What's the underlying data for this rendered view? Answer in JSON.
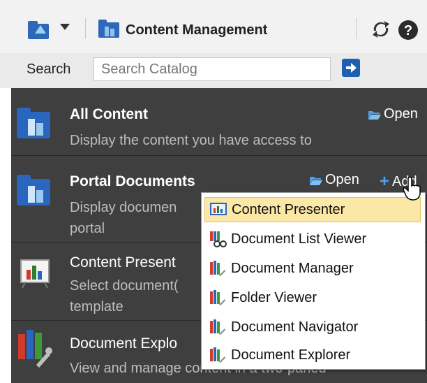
{
  "toolbar": {
    "title": "Content Management",
    "icons": [
      "add-folder-icon",
      "dropdown-arrow-icon",
      "content-management-icon",
      "refresh-icon",
      "help-icon"
    ]
  },
  "search": {
    "label": "Search",
    "placeholder": "Search Catalog",
    "go_icon": "arrow-right-icon"
  },
  "items": [
    {
      "title": "All Content",
      "description": "Display the content you have access to",
      "open_label": "Open",
      "icon": "folder-building-icon"
    },
    {
      "title": "Portal Documents",
      "description_line1": "Display documen",
      "description_line2": "portal",
      "open_label": "Open",
      "add_label": "Add",
      "icon": "folder-building-icon"
    },
    {
      "title": "Content Present",
      "description_line1": "Select document(",
      "description_line2": "template",
      "icon": "presenter-icon"
    },
    {
      "title": "Document Explo",
      "description_line1": "View and manage content in a two-paned",
      "icon": "document-explorer-icon"
    }
  ],
  "popup_menu": [
    {
      "label": "Content Presenter",
      "icon": "presenter-icon",
      "selected": true
    },
    {
      "label": "Document List Viewer",
      "icon": "document-list-viewer-icon"
    },
    {
      "label": "Document Manager",
      "icon": "books-icon"
    },
    {
      "label": "Folder Viewer",
      "icon": "books-icon"
    },
    {
      "label": "Document Navigator",
      "icon": "books-icon"
    },
    {
      "label": "Document Explorer",
      "icon": "books-icon"
    }
  ],
  "colors": {
    "list_background": "#3f3f3f",
    "accent_blue": "#1d5fb0",
    "selected_menu": "#fbe7a6"
  }
}
